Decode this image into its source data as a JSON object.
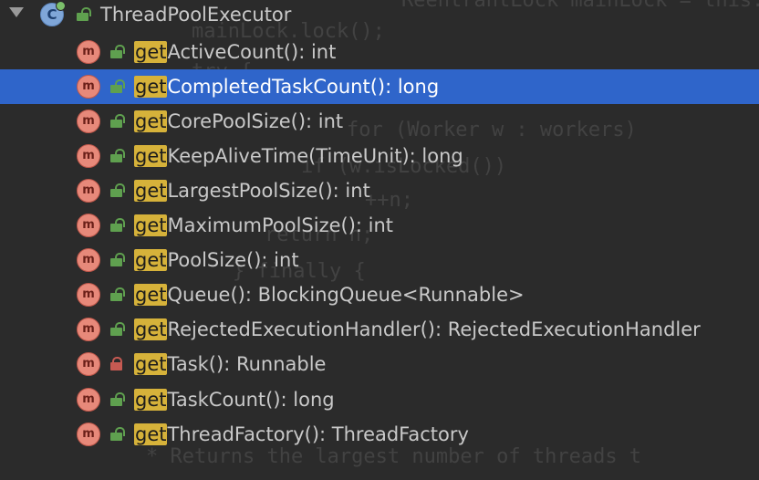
{
  "background_code": [
    "ReentrantLock mainLock = this.ma",
    "mainLock.lock();",
    "try {",
    "for (Worker w : workers)",
    "if (w.isLocked())",
    "++n;",
    "return n;",
    "} finally {",
    "* Returns the largest number of threads t"
  ],
  "tree": {
    "root": {
      "label": "ThreadPoolExecutor",
      "icon": "class-icon",
      "badge": "C"
    },
    "search_highlight": "get",
    "items": [
      {
        "match": "get",
        "rest": "ActiveCount(): int",
        "access": "public",
        "selected": false
      },
      {
        "match": "get",
        "rest": "CompletedTaskCount(): long",
        "access": "public",
        "selected": true
      },
      {
        "match": "get",
        "rest": "CorePoolSize(): int",
        "access": "public",
        "selected": false
      },
      {
        "match": "get",
        "rest": "KeepAliveTime(TimeUnit): long",
        "access": "public",
        "selected": false
      },
      {
        "match": "get",
        "rest": "LargestPoolSize(): int",
        "access": "public",
        "selected": false
      },
      {
        "match": "get",
        "rest": "MaximumPoolSize(): int",
        "access": "public",
        "selected": false
      },
      {
        "match": "get",
        "rest": "PoolSize(): int",
        "access": "public",
        "selected": false
      },
      {
        "match": "get",
        "rest": "Queue(): BlockingQueue<Runnable>",
        "access": "public",
        "selected": false
      },
      {
        "match": "get",
        "rest": "RejectedExecutionHandler(): RejectedExecutionHandler",
        "access": "public",
        "selected": false
      },
      {
        "match": "get",
        "rest": "Task(): Runnable",
        "access": "private",
        "selected": false
      },
      {
        "match": "get",
        "rest": "TaskCount(): long",
        "access": "public",
        "selected": false
      },
      {
        "match": "get",
        "rest": "ThreadFactory(): ThreadFactory",
        "access": "public",
        "selected": false
      }
    ],
    "method_badge": "m"
  },
  "colors": {
    "background": "#2b2b2b",
    "selection": "#2f65ca",
    "highlight": "#d6b23a",
    "method_icon": "#e7897a",
    "public_lock": "#5fa04f",
    "private_lock": "#c65a52"
  }
}
